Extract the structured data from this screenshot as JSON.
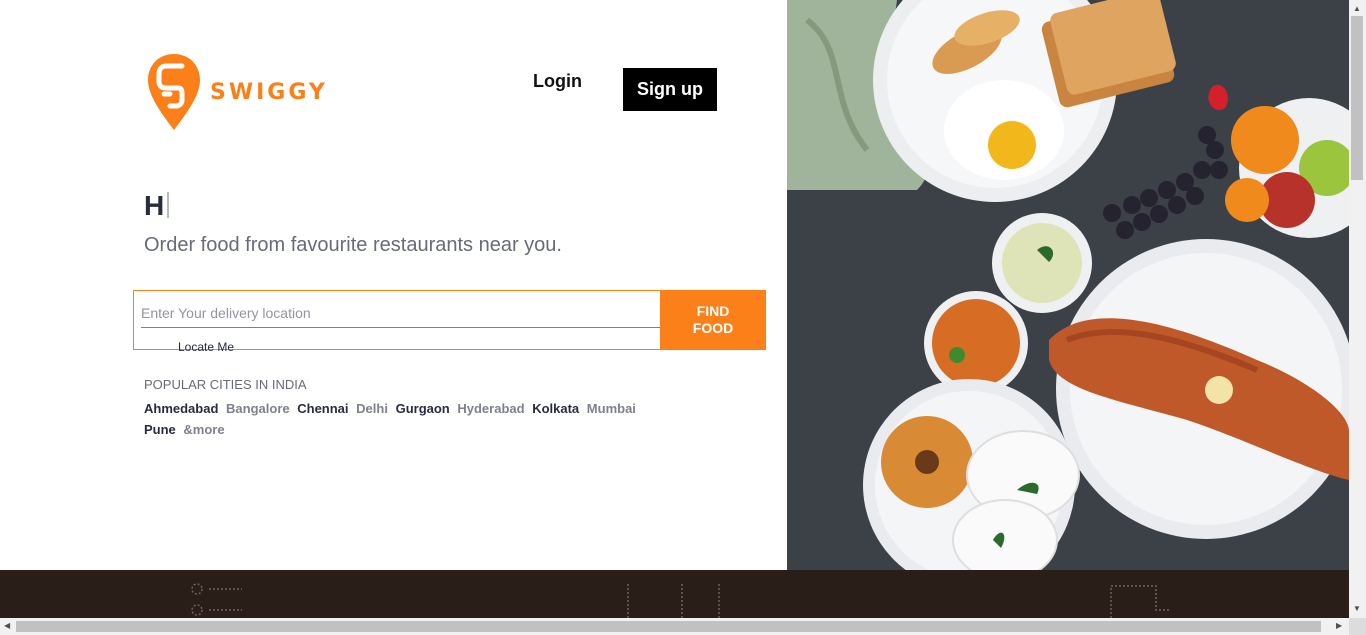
{
  "brand": {
    "name": "SWIGGY",
    "color": "#fc8019"
  },
  "nav": {
    "login_label": "Login",
    "signup_label": "Sign up"
  },
  "hero": {
    "headline": "H",
    "subheadline": "Order food from favourite restaurants near you."
  },
  "search": {
    "placeholder": "Enter Your delivery location",
    "value": "",
    "locate_label": "Locate Me",
    "find_button_line1": "FIND",
    "find_button_line2": "FOOD"
  },
  "cities": {
    "title": "POPULAR CITIES IN INDIA",
    "items": [
      "Ahmedabad",
      "Bangalore",
      "Chennai",
      "Delhi",
      "Gurgaon",
      "Hyderabad",
      "Kolkata",
      "Mumbai",
      "Pune",
      "&more"
    ]
  },
  "hero_image": {
    "description_icon": "food-platter-image"
  }
}
